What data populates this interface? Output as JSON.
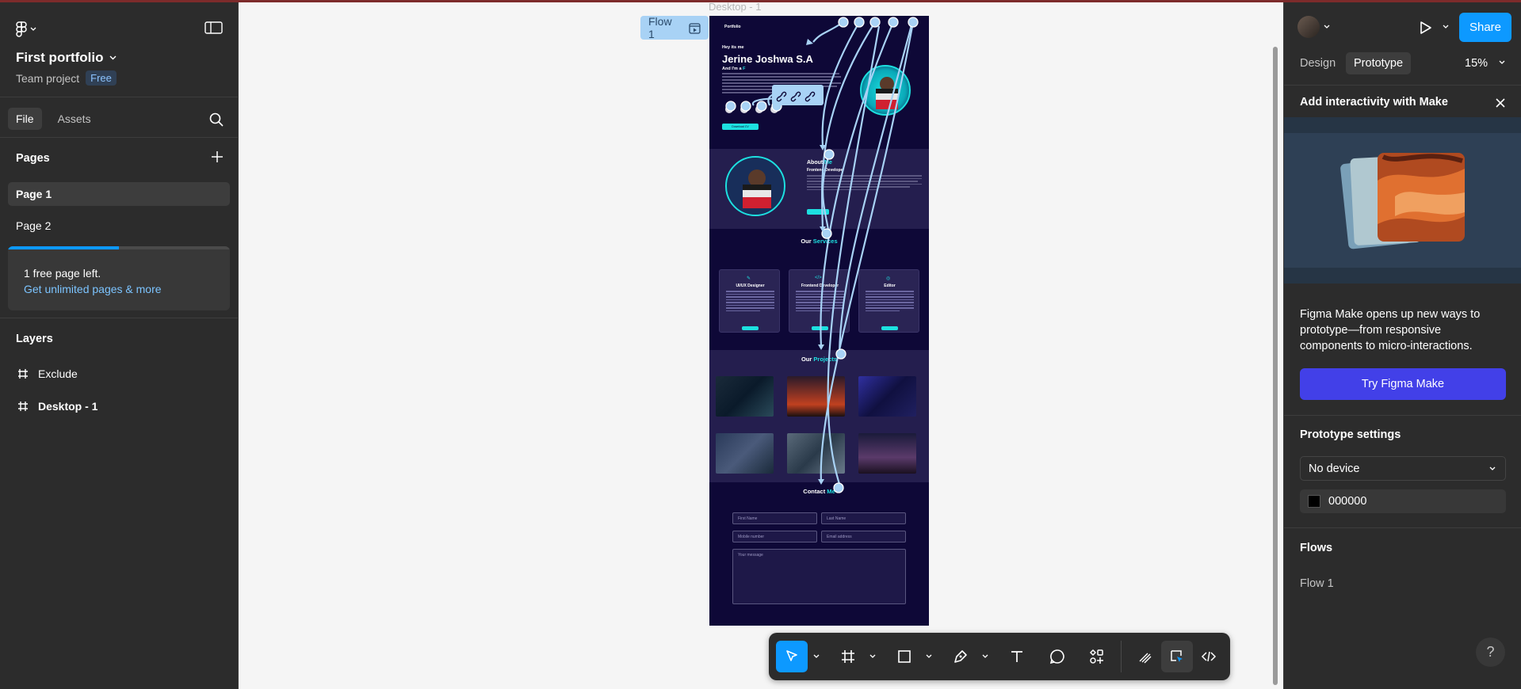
{
  "file": {
    "title": "First portfolio",
    "team": "Team project",
    "plan_badge": "Free"
  },
  "left_tabs": [
    "File",
    "Assets"
  ],
  "pages": {
    "heading": "Pages",
    "items": [
      "Page 1",
      "Page 2"
    ],
    "active": "Page 1"
  },
  "upsell": {
    "line1": "1 free page left.",
    "link": "Get unlimited pages & more",
    "progress": 0.5
  },
  "layers": {
    "heading": "Layers",
    "items": [
      {
        "name": "Exclude",
        "icon": "exclude-icon"
      },
      {
        "name": "Desktop - 1",
        "icon": "frame-icon"
      }
    ]
  },
  "canvas": {
    "frame_label": "Desktop - 1",
    "flow_tag": "Flow 1"
  },
  "portfolio": {
    "brand": "Portfolio",
    "hey": "Hey its me",
    "name": "Jerine Joshwa S.A",
    "im": "And I'm a",
    "im_hl": "F",
    "download": "Download CV",
    "about_title": "About",
    "about_hl": "Me",
    "about_sub": "Frontend Developer",
    "services_title": "Our",
    "services_hl": "Services",
    "cards": [
      {
        "title": "UI/UX Designer",
        "icon": "pen-icon"
      },
      {
        "title": "Frontend Developer",
        "icon": "code-icon"
      },
      {
        "title": "Editor",
        "icon": "edit-icon"
      }
    ],
    "projects_title": "Our",
    "projects_hl": "Projects",
    "contact_title": "Contact",
    "contact_hl": "Me",
    "fields": [
      "First Name",
      "Last Name",
      "Mobile number",
      "Email address"
    ],
    "message": "Your message"
  },
  "right": {
    "share": "Share",
    "tabs": [
      "Design",
      "Prototype"
    ],
    "active_tab": "Prototype",
    "zoom": "15%",
    "make_heading": "Add interactivity with Make",
    "make_text": "Figma Make opens up new ways to prototype—from responsive components to micro-interactions.",
    "make_button": "Try Figma Make",
    "proto_heading": "Prototype settings",
    "device": "No device",
    "bg_color": "000000",
    "flows_heading": "Flows",
    "flows": [
      "Flow 1"
    ],
    "help": "?"
  },
  "colors": {
    "accent": "#0d99ff",
    "cyan": "#1de0e0",
    "frame_bg": "#0e0837",
    "make_button": "#4240e8"
  }
}
